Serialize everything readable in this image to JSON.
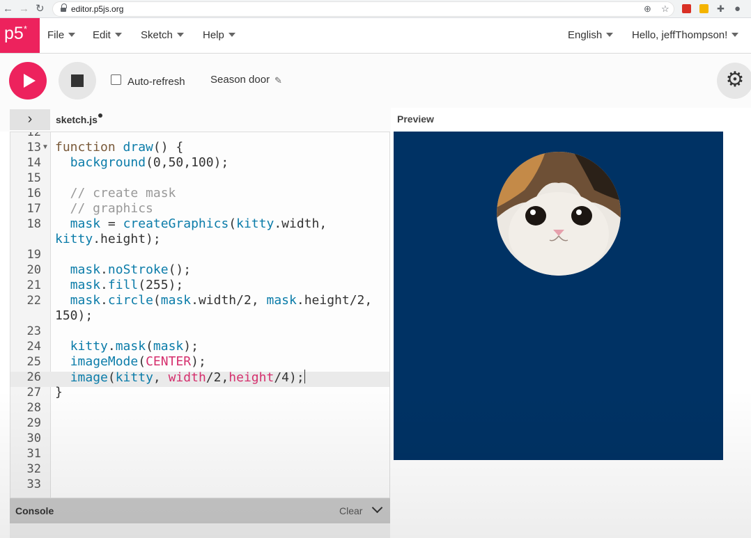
{
  "browser": {
    "url": "editor.p5js.org"
  },
  "app": {
    "logo": "p5"
  },
  "menu": {
    "items": [
      {
        "label": "File"
      },
      {
        "label": "Edit"
      },
      {
        "label": "Sketch"
      },
      {
        "label": "Help"
      }
    ],
    "language": "English",
    "user": "Hello, jeffThompson!"
  },
  "toolbar": {
    "auto_refresh_label": "Auto-refresh",
    "auto_refresh_checked": false,
    "project_name": "Season door"
  },
  "editor": {
    "file_name": "sketch.js",
    "unsaved": true,
    "lines": [
      {
        "n": "12",
        "code": ""
      },
      {
        "n": "13",
        "code": "function draw() {"
      },
      {
        "n": "14",
        "code": "  background(0,50,100);"
      },
      {
        "n": "15",
        "code": ""
      },
      {
        "n": "16",
        "code": "  // create mask"
      },
      {
        "n": "17",
        "code": "  // graphics"
      },
      {
        "n": "18",
        "code": "  mask = createGraphics(kitty.width,"
      },
      {
        "n": "",
        "code": "kitty.height);"
      },
      {
        "n": "19",
        "code": ""
      },
      {
        "n": "20",
        "code": "  mask.noStroke();"
      },
      {
        "n": "21",
        "code": "  mask.fill(255);"
      },
      {
        "n": "22",
        "code": "  mask.circle(mask.width/2, mask.height/2,"
      },
      {
        "n": "",
        "code": "150);"
      },
      {
        "n": "23",
        "code": ""
      },
      {
        "n": "24",
        "code": "  kitty.mask(mask);"
      },
      {
        "n": "25",
        "code": "  imageMode(CENTER);"
      },
      {
        "n": "26",
        "code": "  image(kitty, width/2,height/4);"
      },
      {
        "n": "27",
        "code": "}"
      },
      {
        "n": "28",
        "code": ""
      },
      {
        "n": "29",
        "code": ""
      },
      {
        "n": "30",
        "code": ""
      },
      {
        "n": "31",
        "code": ""
      },
      {
        "n": "32",
        "code": ""
      },
      {
        "n": "33",
        "code": ""
      }
    ]
  },
  "preview": {
    "label": "Preview",
    "background": "#003264"
  },
  "console": {
    "label": "Console",
    "clear_label": "Clear"
  },
  "colors": {
    "accent": "#ed225d",
    "keyword": "#7a5a3a",
    "function": "#0b7ca9",
    "comment": "#999999",
    "constant": "#d52f6d"
  }
}
